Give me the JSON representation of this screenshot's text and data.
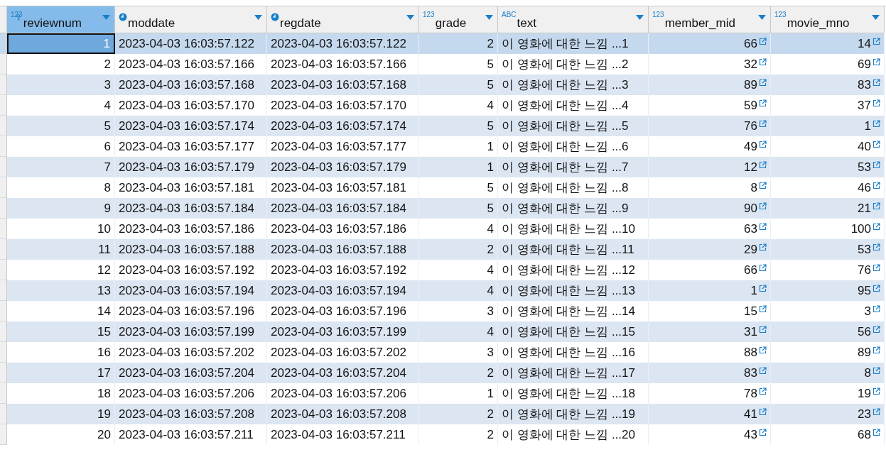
{
  "columns": [
    {
      "name": "reviewnum",
      "kind": "number",
      "type_label": "123",
      "key": true,
      "selected": true
    },
    {
      "name": "moddate",
      "kind": "datetime",
      "selected": false
    },
    {
      "name": "regdate",
      "kind": "datetime",
      "selected": false
    },
    {
      "name": "grade",
      "kind": "number",
      "type_label": "123",
      "selected": false
    },
    {
      "name": "text",
      "kind": "text",
      "type_label": "ABC",
      "selected": false
    },
    {
      "name": "member_mid",
      "kind": "number",
      "type_label": "123",
      "link": true,
      "selected": false
    },
    {
      "name": "movie_mno",
      "kind": "number",
      "type_label": "123",
      "link": true,
      "selected": false
    }
  ],
  "rows": [
    {
      "selected": true,
      "cells": [
        "1",
        "2023-04-03 16:03:57.122",
        "2023-04-03 16:03:57.122",
        "2",
        "이 영화에 대한 느낌 ...1",
        "66",
        "14"
      ]
    },
    {
      "selected": false,
      "cells": [
        "2",
        "2023-04-03 16:03:57.166",
        "2023-04-03 16:03:57.166",
        "5",
        "이 영화에 대한 느낌 ...2",
        "32",
        "69"
      ]
    },
    {
      "selected": false,
      "cells": [
        "3",
        "2023-04-03 16:03:57.168",
        "2023-04-03 16:03:57.168",
        "5",
        "이 영화에 대한 느낌 ...3",
        "89",
        "83"
      ]
    },
    {
      "selected": false,
      "cells": [
        "4",
        "2023-04-03 16:03:57.170",
        "2023-04-03 16:03:57.170",
        "4",
        "이 영화에 대한 느낌 ...4",
        "59",
        "37"
      ]
    },
    {
      "selected": false,
      "cells": [
        "5",
        "2023-04-03 16:03:57.174",
        "2023-04-03 16:03:57.174",
        "5",
        "이 영화에 대한 느낌 ...5",
        "76",
        "1"
      ]
    },
    {
      "selected": false,
      "cells": [
        "6",
        "2023-04-03 16:03:57.177",
        "2023-04-03 16:03:57.177",
        "1",
        "이 영화에 대한 느낌 ...6",
        "49",
        "40"
      ]
    },
    {
      "selected": false,
      "cells": [
        "7",
        "2023-04-03 16:03:57.179",
        "2023-04-03 16:03:57.179",
        "1",
        "이 영화에 대한 느낌 ...7",
        "12",
        "53"
      ]
    },
    {
      "selected": false,
      "cells": [
        "8",
        "2023-04-03 16:03:57.181",
        "2023-04-03 16:03:57.181",
        "5",
        "이 영화에 대한 느낌 ...8",
        "8",
        "46"
      ]
    },
    {
      "selected": false,
      "cells": [
        "9",
        "2023-04-03 16:03:57.184",
        "2023-04-03 16:03:57.184",
        "5",
        "이 영화에 대한 느낌 ...9",
        "90",
        "21"
      ]
    },
    {
      "selected": false,
      "cells": [
        "10",
        "2023-04-03 16:03:57.186",
        "2023-04-03 16:03:57.186",
        "4",
        "이 영화에 대한 느낌 ...10",
        "63",
        "100"
      ]
    },
    {
      "selected": false,
      "cells": [
        "11",
        "2023-04-03 16:03:57.188",
        "2023-04-03 16:03:57.188",
        "2",
        "이 영화에 대한 느낌 ...11",
        "29",
        "53"
      ]
    },
    {
      "selected": false,
      "cells": [
        "12",
        "2023-04-03 16:03:57.192",
        "2023-04-03 16:03:57.192",
        "4",
        "이 영화에 대한 느낌 ...12",
        "66",
        "76"
      ]
    },
    {
      "selected": false,
      "cells": [
        "13",
        "2023-04-03 16:03:57.194",
        "2023-04-03 16:03:57.194",
        "4",
        "이 영화에 대한 느낌 ...13",
        "1",
        "95"
      ]
    },
    {
      "selected": false,
      "cells": [
        "14",
        "2023-04-03 16:03:57.196",
        "2023-04-03 16:03:57.196",
        "3",
        "이 영화에 대한 느낌 ...14",
        "15",
        "3"
      ]
    },
    {
      "selected": false,
      "cells": [
        "15",
        "2023-04-03 16:03:57.199",
        "2023-04-03 16:03:57.199",
        "4",
        "이 영화에 대한 느낌 ...15",
        "31",
        "56"
      ]
    },
    {
      "selected": false,
      "cells": [
        "16",
        "2023-04-03 16:03:57.202",
        "2023-04-03 16:03:57.202",
        "3",
        "이 영화에 대한 느낌 ...16",
        "88",
        "89"
      ]
    },
    {
      "selected": false,
      "cells": [
        "17",
        "2023-04-03 16:03:57.204",
        "2023-04-03 16:03:57.204",
        "2",
        "이 영화에 대한 느낌 ...17",
        "83",
        "8"
      ]
    },
    {
      "selected": false,
      "cells": [
        "18",
        "2023-04-03 16:03:57.206",
        "2023-04-03 16:03:57.206",
        "1",
        "이 영화에 대한 느낌 ...18",
        "78",
        "19"
      ]
    },
    {
      "selected": false,
      "cells": [
        "19",
        "2023-04-03 16:03:57.208",
        "2023-04-03 16:03:57.208",
        "2",
        "이 영화에 대한 느낌 ...19",
        "41",
        "23"
      ]
    },
    {
      "selected": false,
      "cells": [
        "20",
        "2023-04-03 16:03:57.211",
        "2023-04-03 16:03:57.211",
        "2",
        "이 영화에 대한 느낌 ...20",
        "43",
        "68"
      ]
    }
  ]
}
